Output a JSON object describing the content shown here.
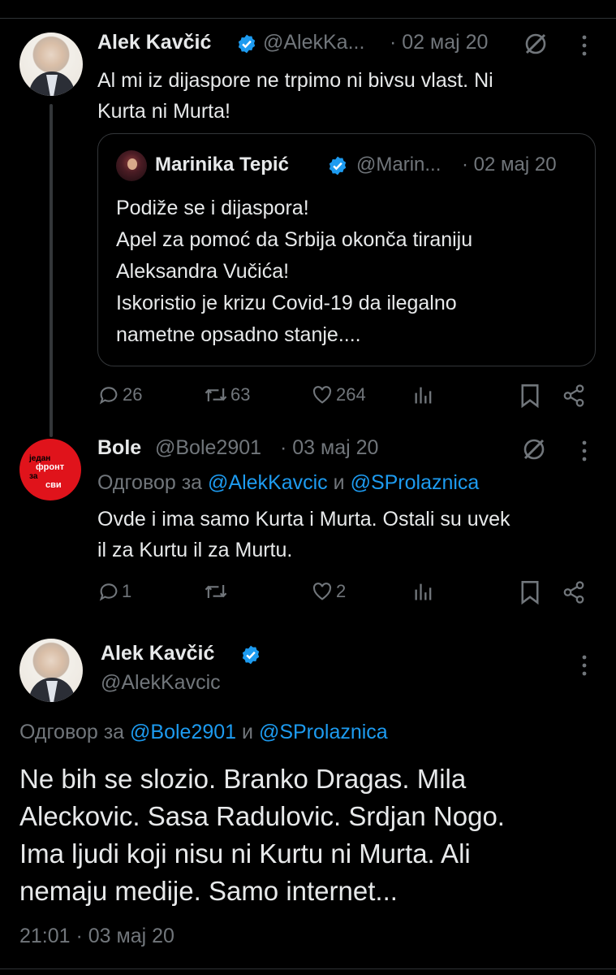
{
  "tweet1": {
    "name": "Alek Kavčić",
    "handle": "@AlekKa...",
    "date": "· 02 мај 20",
    "text_line1": "Al mi iz dijaspore ne trpimo ni bivsu vlast. Ni",
    "text_line2": "Kurta ni Murta!",
    "stats": {
      "replies": "26",
      "reposts": "63",
      "likes": "264"
    }
  },
  "quote": {
    "name": "Marinika Tepić",
    "handle": "@Marin...",
    "date": "· 02 мај 20",
    "lines": [
      "Podiže se i dijaspora!",
      "Apel za pomoć da Srbija okonča tiraniju",
      "Aleksandra Vučića!",
      "Iskoristio je krizu Covid-19 da ilegalno",
      "nametne opsadno stanje...."
    ]
  },
  "tweet2": {
    "name": "Bole",
    "handle": "@Bole2901",
    "date": "· 03 мај 20",
    "reply_prefix": "Одговор за",
    "reply_to1": "@AlekKavcic",
    "reply_and": "и",
    "reply_to2": "@SProlaznica",
    "text_line1": "Ovde i ima samo Kurta i Murta. Ostali su uvek",
    "text_line2": "il za Kurtu il za Murtu.",
    "avatar_text": {
      "l1": "један",
      "l2": "фронт",
      "l3": "за",
      "l4": "сви"
    },
    "stats": {
      "replies": "1",
      "likes": "2"
    }
  },
  "tweet3": {
    "name": "Alek Kavčić",
    "handle": "@AlekKavcic",
    "reply_prefix": "Одговор за",
    "reply_to1": "@Bole2901",
    "reply_and": "и",
    "reply_to2": "@SProlaznica",
    "lines": [
      "Ne bih se slozio. Branko Dragas. Mila",
      "Aleckovic. Sasa Radulovic. Srdjan Nogo.",
      "Ima ljudi koji nisu ni Kurtu ni Murta. Ali",
      "nemaju medije. Samo internet..."
    ],
    "timestamp": "21:01 · 03 мај 20"
  },
  "colors": {
    "accent": "#1d9bf0",
    "muted": "#71767b",
    "background": "#000000",
    "text": "#e7e9ea",
    "border": "#333639"
  },
  "icons": [
    "verified-badge-icon",
    "grok-icon",
    "more-icon",
    "reply-icon",
    "repost-icon",
    "like-icon",
    "views-icon",
    "bookmark-icon",
    "share-icon"
  ]
}
